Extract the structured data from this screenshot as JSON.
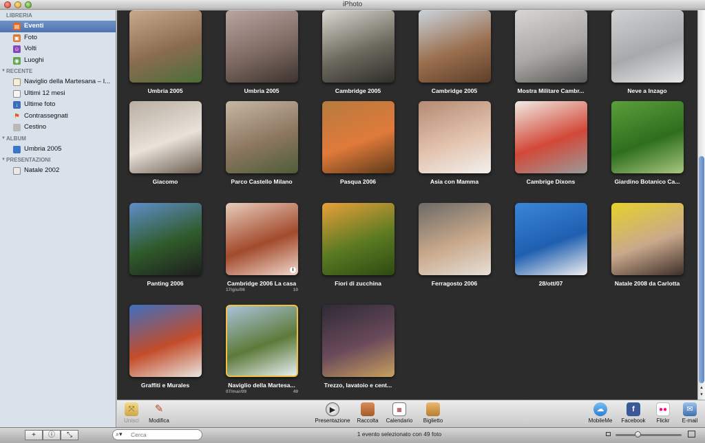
{
  "window": {
    "title": "iPhoto"
  },
  "sidebar": {
    "sections": [
      {
        "title": "LIBRERIA",
        "items": [
          {
            "label": "Eventi",
            "icon": "events-icon",
            "selected": true
          },
          {
            "label": "Foto",
            "icon": "photos-icon"
          },
          {
            "label": "Volti",
            "icon": "faces-icon"
          },
          {
            "label": "Luoghi",
            "icon": "places-icon"
          }
        ]
      },
      {
        "title": "RECENTE",
        "items": [
          {
            "label": "Naviglio della Martesana – I...",
            "icon": "event-album-icon"
          },
          {
            "label": "Ultimi 12 mesi",
            "icon": "calendar-icon"
          },
          {
            "label": "Ultime foto",
            "icon": "import-icon"
          },
          {
            "label": "Contrassegnati",
            "icon": "flag-icon"
          },
          {
            "label": "Cestino",
            "icon": "trash-icon"
          }
        ]
      },
      {
        "title": "ALBUM",
        "items": [
          {
            "label": "Umbria 2005",
            "icon": "album-icon"
          }
        ]
      },
      {
        "title": "PRESENTAZIONI",
        "items": [
          {
            "label": "Natale 2002",
            "icon": "slideshow-icon"
          }
        ]
      }
    ]
  },
  "events": [
    {
      "name": "Umbria 2005",
      "colors": [
        "#c9a98c",
        "#8a6b4f",
        "#4a6e3a"
      ]
    },
    {
      "name": "Umbria 2005",
      "colors": [
        "#b9a6a0",
        "#7e6a63",
        "#3d332e"
      ]
    },
    {
      "name": "Cambridge 2005",
      "colors": [
        "#d9d7cf",
        "#6d6a5f",
        "#2f2e2a"
      ]
    },
    {
      "name": "Cambridge 2005",
      "colors": [
        "#c9d3dc",
        "#9a6f4e",
        "#5d3f2a"
      ]
    },
    {
      "name": "Mostra Militare Cambr...",
      "colors": [
        "#d8d6d2",
        "#a9a7a3",
        "#5a5a58"
      ]
    },
    {
      "name": "Neve a Inzago",
      "colors": [
        "#cfd1d2",
        "#a7a9aa",
        "#e7e8e9"
      ]
    },
    {
      "name": "Giacomo",
      "colors": [
        "#b9aea0",
        "#e8e2da",
        "#6b5d4f"
      ]
    },
    {
      "name": "Parco Castello Milano",
      "colors": [
        "#c6b8a4",
        "#8c7660",
        "#4e5d38"
      ]
    },
    {
      "name": "Pasqua 2006",
      "colors": [
        "#b67a3e",
        "#e07a3a",
        "#5d3a1a"
      ]
    },
    {
      "name": "Asia con Mamma",
      "colors": [
        "#b48a73",
        "#e3c3ae",
        "#f2f0ee"
      ]
    },
    {
      "name": "Cambrige Dixons",
      "colors": [
        "#f0ece5",
        "#d34838",
        "#9a9a9a"
      ]
    },
    {
      "name": "Giardino Botanico Ca...",
      "colors": [
        "#5aa03a",
        "#2e6e1e",
        "#a9c77e"
      ]
    },
    {
      "name": "Panting 2006",
      "colors": [
        "#5e8ec9",
        "#2f5a2a",
        "#1e1e1e"
      ]
    },
    {
      "name": "Cambridge 2006 La casa",
      "colors": [
        "#e8cdbd",
        "#a24a2c",
        "#f0d8cc"
      ],
      "date": "17/giu/06",
      "count": "10",
      "info": true
    },
    {
      "name": "Fiori di zucchina",
      "colors": [
        "#e8a03a",
        "#5b7a22",
        "#2e4a12"
      ]
    },
    {
      "name": "Ferragosto 2006",
      "colors": [
        "#6c6a66",
        "#c9a98c",
        "#e6e0d8"
      ]
    },
    {
      "name": "28/ott/07",
      "colors": [
        "#3a86d8",
        "#1f5fb0",
        "#f0f0f0"
      ]
    },
    {
      "name": "Natale 2008 da Carlotta",
      "colors": [
        "#e6d12a",
        "#c9a98c",
        "#3e2f2a"
      ]
    },
    {
      "name": "Graffiti e Murales",
      "colors": [
        "#3e6fbf",
        "#c34c2a",
        "#e9e6e1"
      ]
    },
    {
      "name": "Naviglio della Martesa...",
      "colors": [
        "#a9c3d8",
        "#5d7a3a",
        "#e6eef2"
      ],
      "date": "07/mar/09",
      "count": "49",
      "highlight": true
    },
    {
      "name": "Trezzo, lavatoio e cent...",
      "colors": [
        "#2e2a36",
        "#6a4a5a",
        "#c9a060"
      ]
    }
  ],
  "toolbar": {
    "left": [
      {
        "label": "Unisci",
        "icon": "merge-icon",
        "disabled": true
      },
      {
        "label": "Modifica",
        "icon": "edit-pencil-icon"
      }
    ],
    "center": [
      {
        "label": "Presentazione",
        "icon": "play-icon"
      },
      {
        "label": "Raccolta",
        "icon": "book-icon"
      },
      {
        "label": "Calendario",
        "icon": "calendar-icon"
      },
      {
        "label": "Biglietto",
        "icon": "card-icon"
      }
    ],
    "right": [
      {
        "label": "MobileMe",
        "icon": "mobileme-icon"
      },
      {
        "label": "Facebook",
        "icon": "facebook-icon"
      },
      {
        "label": "Flickr",
        "icon": "flickr-icon"
      },
      {
        "label": "E-mail",
        "icon": "email-icon"
      }
    ]
  },
  "bottombar": {
    "search_placeholder": "Cerca",
    "status": "1 evento selezionato con 49 foto",
    "zoom_level": 0.33
  }
}
